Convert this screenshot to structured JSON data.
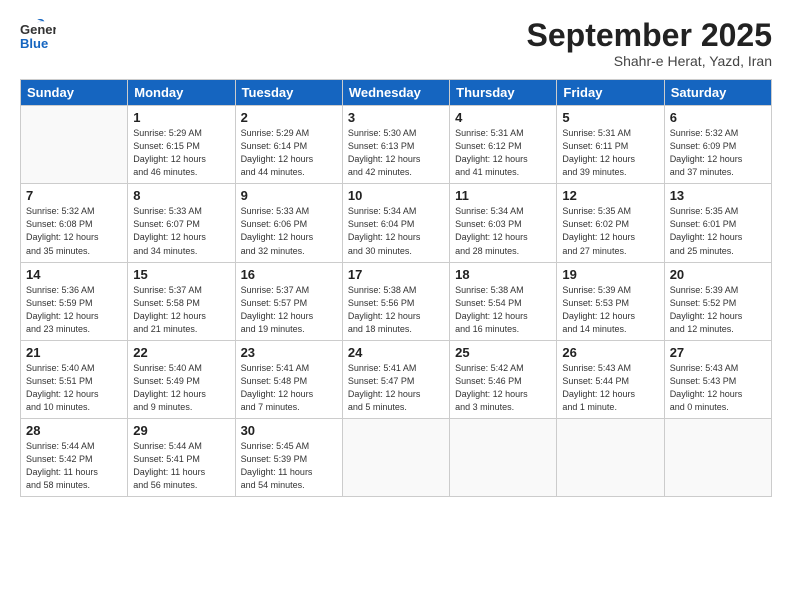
{
  "logo": {
    "general": "General",
    "blue": "Blue"
  },
  "title": "September 2025",
  "location": "Shahr-e Herat, Yazd, Iran",
  "days_of_week": [
    "Sunday",
    "Monday",
    "Tuesday",
    "Wednesday",
    "Thursday",
    "Friday",
    "Saturday"
  ],
  "weeks": [
    [
      {
        "day": "",
        "info": ""
      },
      {
        "day": "1",
        "info": "Sunrise: 5:29 AM\nSunset: 6:15 PM\nDaylight: 12 hours\nand 46 minutes."
      },
      {
        "day": "2",
        "info": "Sunrise: 5:29 AM\nSunset: 6:14 PM\nDaylight: 12 hours\nand 44 minutes."
      },
      {
        "day": "3",
        "info": "Sunrise: 5:30 AM\nSunset: 6:13 PM\nDaylight: 12 hours\nand 42 minutes."
      },
      {
        "day": "4",
        "info": "Sunrise: 5:31 AM\nSunset: 6:12 PM\nDaylight: 12 hours\nand 41 minutes."
      },
      {
        "day": "5",
        "info": "Sunrise: 5:31 AM\nSunset: 6:11 PM\nDaylight: 12 hours\nand 39 minutes."
      },
      {
        "day": "6",
        "info": "Sunrise: 5:32 AM\nSunset: 6:09 PM\nDaylight: 12 hours\nand 37 minutes."
      }
    ],
    [
      {
        "day": "7",
        "info": "Sunrise: 5:32 AM\nSunset: 6:08 PM\nDaylight: 12 hours\nand 35 minutes."
      },
      {
        "day": "8",
        "info": "Sunrise: 5:33 AM\nSunset: 6:07 PM\nDaylight: 12 hours\nand 34 minutes."
      },
      {
        "day": "9",
        "info": "Sunrise: 5:33 AM\nSunset: 6:06 PM\nDaylight: 12 hours\nand 32 minutes."
      },
      {
        "day": "10",
        "info": "Sunrise: 5:34 AM\nSunset: 6:04 PM\nDaylight: 12 hours\nand 30 minutes."
      },
      {
        "day": "11",
        "info": "Sunrise: 5:34 AM\nSunset: 6:03 PM\nDaylight: 12 hours\nand 28 minutes."
      },
      {
        "day": "12",
        "info": "Sunrise: 5:35 AM\nSunset: 6:02 PM\nDaylight: 12 hours\nand 27 minutes."
      },
      {
        "day": "13",
        "info": "Sunrise: 5:35 AM\nSunset: 6:01 PM\nDaylight: 12 hours\nand 25 minutes."
      }
    ],
    [
      {
        "day": "14",
        "info": "Sunrise: 5:36 AM\nSunset: 5:59 PM\nDaylight: 12 hours\nand 23 minutes."
      },
      {
        "day": "15",
        "info": "Sunrise: 5:37 AM\nSunset: 5:58 PM\nDaylight: 12 hours\nand 21 minutes."
      },
      {
        "day": "16",
        "info": "Sunrise: 5:37 AM\nSunset: 5:57 PM\nDaylight: 12 hours\nand 19 minutes."
      },
      {
        "day": "17",
        "info": "Sunrise: 5:38 AM\nSunset: 5:56 PM\nDaylight: 12 hours\nand 18 minutes."
      },
      {
        "day": "18",
        "info": "Sunrise: 5:38 AM\nSunset: 5:54 PM\nDaylight: 12 hours\nand 16 minutes."
      },
      {
        "day": "19",
        "info": "Sunrise: 5:39 AM\nSunset: 5:53 PM\nDaylight: 12 hours\nand 14 minutes."
      },
      {
        "day": "20",
        "info": "Sunrise: 5:39 AM\nSunset: 5:52 PM\nDaylight: 12 hours\nand 12 minutes."
      }
    ],
    [
      {
        "day": "21",
        "info": "Sunrise: 5:40 AM\nSunset: 5:51 PM\nDaylight: 12 hours\nand 10 minutes."
      },
      {
        "day": "22",
        "info": "Sunrise: 5:40 AM\nSunset: 5:49 PM\nDaylight: 12 hours\nand 9 minutes."
      },
      {
        "day": "23",
        "info": "Sunrise: 5:41 AM\nSunset: 5:48 PM\nDaylight: 12 hours\nand 7 minutes."
      },
      {
        "day": "24",
        "info": "Sunrise: 5:41 AM\nSunset: 5:47 PM\nDaylight: 12 hours\nand 5 minutes."
      },
      {
        "day": "25",
        "info": "Sunrise: 5:42 AM\nSunset: 5:46 PM\nDaylight: 12 hours\nand 3 minutes."
      },
      {
        "day": "26",
        "info": "Sunrise: 5:43 AM\nSunset: 5:44 PM\nDaylight: 12 hours\nand 1 minute."
      },
      {
        "day": "27",
        "info": "Sunrise: 5:43 AM\nSunset: 5:43 PM\nDaylight: 12 hours\nand 0 minutes."
      }
    ],
    [
      {
        "day": "28",
        "info": "Sunrise: 5:44 AM\nSunset: 5:42 PM\nDaylight: 11 hours\nand 58 minutes."
      },
      {
        "day": "29",
        "info": "Sunrise: 5:44 AM\nSunset: 5:41 PM\nDaylight: 11 hours\nand 56 minutes."
      },
      {
        "day": "30",
        "info": "Sunrise: 5:45 AM\nSunset: 5:39 PM\nDaylight: 11 hours\nand 54 minutes."
      },
      {
        "day": "",
        "info": ""
      },
      {
        "day": "",
        "info": ""
      },
      {
        "day": "",
        "info": ""
      },
      {
        "day": "",
        "info": ""
      }
    ]
  ]
}
